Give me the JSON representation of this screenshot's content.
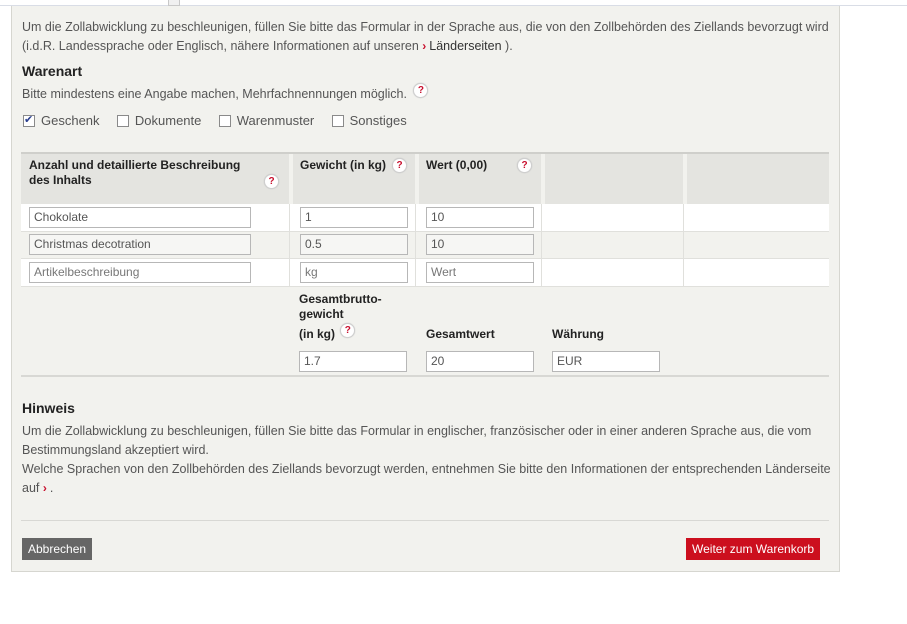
{
  "intro": {
    "text": "Um die Zollabwicklung zu beschleunigen, füllen Sie bitte das Formular in der Sprache aus, die von den Zollbehörden des Ziellands bevorzugt wird (i.d.R. Landessprache oder Englisch, nähere Informationen auf unseren",
    "link": "Länderseiten",
    "after": ")."
  },
  "warenart": {
    "title": "Warenart",
    "subtitle": "Bitte mindestens eine Angabe machen, Mehrfachnennungen möglich.",
    "options": [
      {
        "label": "Geschenk",
        "checked": true
      },
      {
        "label": "Dokumente",
        "checked": false
      },
      {
        "label": "Warenmuster",
        "checked": false
      },
      {
        "label": "Sonstiges",
        "checked": false
      }
    ]
  },
  "table": {
    "headers": {
      "description": "Anzahl und detaillierte Beschreibung des Inhalts",
      "weight": "Gewicht (in kg)",
      "value": "Wert (0,00)"
    },
    "rows": [
      {
        "description": "Chokolate",
        "weight": "1",
        "value": "10"
      },
      {
        "description": "Christmas decotration",
        "weight": "0.5",
        "value": "10"
      },
      {
        "description": "Artikelbeschreibung",
        "weight": "kg",
        "value": "Wert"
      }
    ],
    "placeholders": {
      "description": "Artikelbeschreibung",
      "weight": "kg",
      "value": "Wert"
    }
  },
  "totals": {
    "weight_label_1": "Gesamtbrutto-",
    "weight_label_2": "gewicht",
    "weight_label_3": "(in kg)",
    "weight_value": "1.7",
    "value_label": "Gesamtwert",
    "value_value": "20",
    "currency_label": "Währung",
    "currency_value": "EUR"
  },
  "hinweis": {
    "title": "Hinweis",
    "line1": "Um die Zollabwicklung zu beschleunigen, füllen Sie bitte das Formular in englischer, französischer oder in einer anderen Sprache aus, die vom Bestimmungsland akzeptiert wird.",
    "line2": "Welche Sprachen von den Zollbehörden des Ziellands bevorzugt werden, entnehmen Sie bitte den Informationen der entsprechenden Länderseite auf",
    "after": "."
  },
  "buttons": {
    "cancel": "Abbrechen",
    "next": "Weiter zum Warenkorb"
  },
  "help_glyph": "?",
  "chevron_glyph": "›",
  "colors": {
    "accent": "#cc0f1e",
    "panel": "#f2f2ee",
    "header": "#e4e4e0"
  }
}
